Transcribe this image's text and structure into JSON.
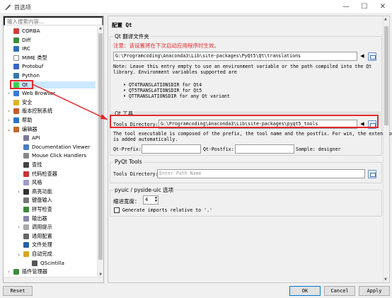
{
  "window": {
    "title": "首选项",
    "minimize_glyph": "—",
    "maximize_glyph": "☐",
    "close_glyph": "✕"
  },
  "search": {
    "placeholder": "输入搜索内容..."
  },
  "tree": {
    "items": [
      {
        "label": "CORBA",
        "icon": "corba-icon",
        "color": "#d03d3d"
      },
      {
        "label": "Diff",
        "icon": "diff-icon",
        "color": "#3b8c3b"
      },
      {
        "label": "IRC",
        "icon": "irc-icon",
        "color": "#2f6fb5"
      },
      {
        "label": "MIME 类型",
        "icon": "mime-icon",
        "color": "#ffffff"
      },
      {
        "label": "Protobuf",
        "icon": "protobuf-icon",
        "color": "#3a65c4"
      },
      {
        "label": "Python",
        "icon": "python-icon",
        "color": "#3776ab"
      },
      {
        "label": "Qt",
        "icon": "qt-icon",
        "color": "#41cd52"
      },
      {
        "label": "Web Browser",
        "icon": "web-browser-icon",
        "color": "#3b7bd1"
      },
      {
        "label": "安全",
        "icon": "security-icon",
        "color": "#e0b22a"
      },
      {
        "label": "版本控制系统",
        "icon": "vcs-icon",
        "color": "#c85a2a"
      },
      {
        "label": "帮助",
        "icon": "help-icon",
        "color": "#2a6fc9"
      },
      {
        "label": "编辑器",
        "icon": "editor-icon",
        "color": "#c46a2c"
      },
      {
        "label": "API",
        "icon": "api-icon",
        "color": "#7a7a9a"
      },
      {
        "label": "Documentation Viewer",
        "icon": "doc-viewer-icon",
        "color": "#4d7fc0"
      },
      {
        "label": "Mouse Click Handlers",
        "icon": "mouse-icon",
        "color": "#888888"
      },
      {
        "label": "查找",
        "icon": "find-icon",
        "color": "#444444"
      },
      {
        "label": "代码检查器",
        "icon": "code-checker-icon",
        "color": "#cc3333"
      },
      {
        "label": "风格",
        "icon": "style-icon",
        "color": "#9c9cc9"
      },
      {
        "label": "高亮功能",
        "icon": "highlight-icon",
        "color": "#333333"
      },
      {
        "label": "键盘输入",
        "icon": "keyboard-icon",
        "color": "#777777"
      },
      {
        "label": "拼写检查",
        "icon": "spellcheck-icon",
        "color": "#3c8a3c"
      },
      {
        "label": "输出器",
        "icon": "exporter-icon",
        "color": "#8888aa"
      },
      {
        "label": "调用提示",
        "icon": "calltip-icon",
        "color": "#aaaaaa"
      },
      {
        "label": "通用配置",
        "icon": "general-config-icon",
        "color": "#666666"
      },
      {
        "label": "文件处理",
        "icon": "file-handling-icon",
        "color": "#2a5fa8"
      },
      {
        "label": "自动完成",
        "icon": "autocomplete-icon",
        "color": "#d9a520"
      },
      {
        "label": "QScintilla",
        "icon": "qscintilla-icon",
        "color": "#555555"
      },
      {
        "label": "插件管理器",
        "icon": "plugin-manager-icon",
        "color": "#3e8a3e"
      }
    ],
    "expand_glyph": "›",
    "collapse_glyph": "⌄"
  },
  "page": {
    "title": "配置 Qt",
    "translations": {
      "group_title": "Qt 翻译文件夹",
      "notice_label": "注意：",
      "notice_text": "该设置将在下次启动应用程序时生效。",
      "path_value": "G:\\Programcoding\\Anaconda3\\Lib\\site-packages\\PyQt5\\Qt\\translations",
      "note_line1": "Note: Leave this entry empty to use an environment variable or the path compiled into the Qt",
      "note_line2": "library. Environment variables supported are",
      "bullets": [
        "QT4TRANSLATIONSDIR for Qt4",
        "QT5TRANSLATIONSDIR for Qt5",
        "QTTRANSLATIONSDIR for any Qt variant"
      ]
    },
    "qt_tools": {
      "group_title": "Qt 工具",
      "tools_dir_label": "Tools Directory:",
      "tools_dir_value": "G:\\Programcoding\\Anaconda3\\Lib\\site-packages\\pyqt5_tools",
      "desc_line1": "The tool executable is composed of the prefix, the tool name and the postfix. For win, the extension",
      "desc_line2": "is added automatically.",
      "prefix_label": "Qt-Prefix:",
      "prefix_value": "",
      "postfix_label": "Qt-Postfix:",
      "postfix_value": "",
      "sample_label": "Sample: designer"
    },
    "pyqt_tools": {
      "group_title": "PyQt Tools",
      "tools_dir_label": "Tools Directory:",
      "tools_dir_placeholder": "Enter Path Name"
    },
    "pyuic": {
      "group_title": "pyuic / pyside-uic 选项",
      "indent_label": "缩进宽度：",
      "indent_value": "4",
      "relative_imports_label": "Generate imports relative to '.'"
    }
  },
  "buttons": {
    "reset": "Reset",
    "ok": "OK",
    "cancel": "Cancel",
    "apply": "Apply"
  },
  "colors": {
    "highlight": "#e2292c",
    "notice": "#e2292c",
    "selection": "#cce8ff"
  }
}
